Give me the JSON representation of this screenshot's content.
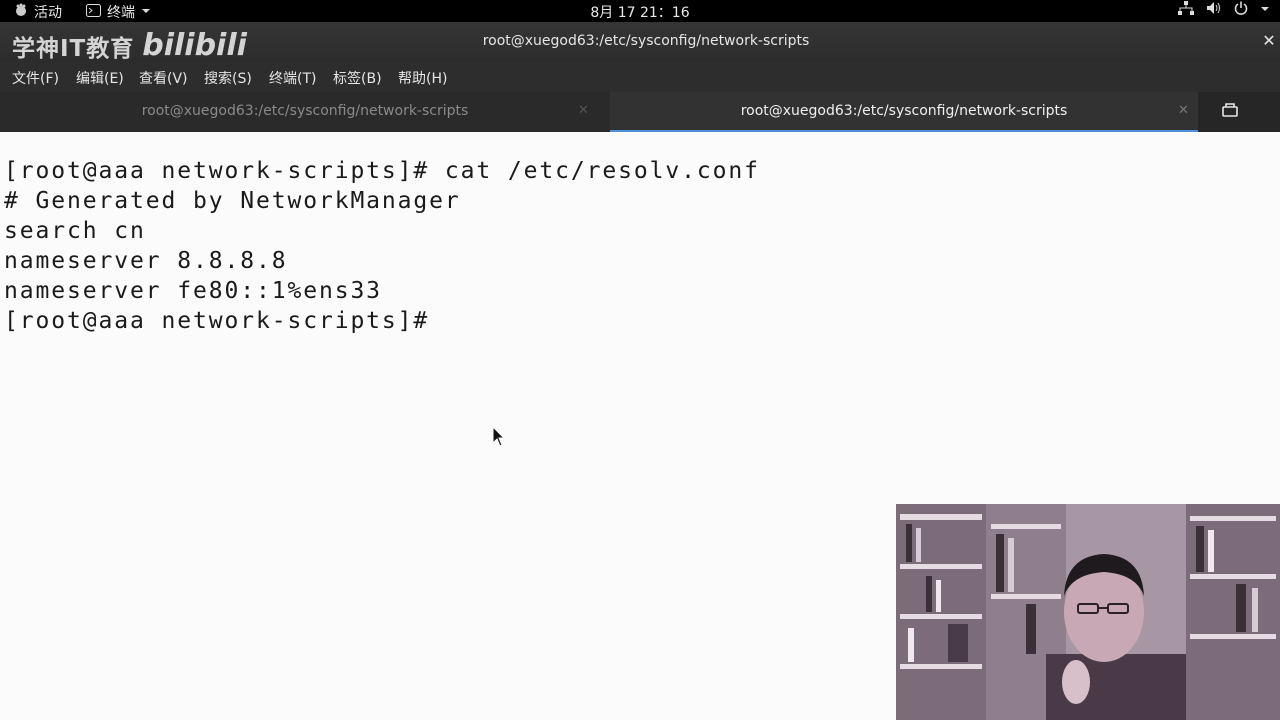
{
  "topbar": {
    "activities_label": "活动",
    "app_menu_label": "终端",
    "clock": "8月 17  21：16",
    "tray_icons": [
      "network-icon",
      "volume-icon",
      "power-icon"
    ]
  },
  "window": {
    "logo_text": "学神IT教育",
    "logo_bili": "bilibili",
    "title": "root@xuegod63:/etc/sysconfig/network-scripts",
    "close_glyph": "✕"
  },
  "menubar": {
    "items": [
      "文件(F)",
      "编辑(E)",
      "查看(V)",
      "搜索(S)",
      "终端(T)",
      "标签(B)",
      "帮助(H)"
    ]
  },
  "tabs": [
    {
      "label": "root@xuegod63:/etc/sysconfig/network-scripts",
      "active": false
    },
    {
      "label": "root@xuegod63:/etc/sysconfig/network-scripts",
      "active": true
    }
  ],
  "terminal": {
    "lines": [
      "[root@aaa network-scripts]# cat /etc/resolv.conf",
      "# Generated by NetworkManager",
      "search cn",
      "nameserver 8.8.8.8",
      "nameserver fe80::1%ens33",
      "[root@aaa network-scripts]#"
    ]
  },
  "colors": {
    "terminal_bg": "#fbfbfb",
    "terminal_fg": "#1a1a1a",
    "chrome_bg": "#2d2d2d",
    "active_tab_accent": "#4a90d9"
  }
}
